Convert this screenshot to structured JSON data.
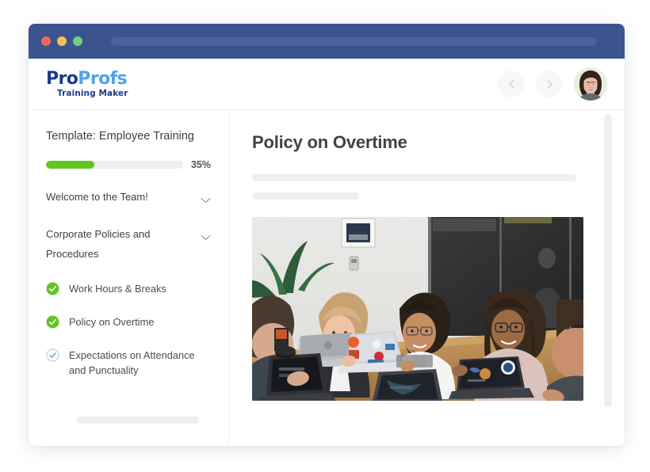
{
  "window": {
    "traffic_lights": [
      "close",
      "minimize",
      "maximize"
    ],
    "colors": {
      "titlebar": "#3b5490",
      "addressbar": "#4a639c",
      "close": "#f1685f",
      "minimize": "#f5c14f",
      "maximize": "#72d07c"
    }
  },
  "header": {
    "logo": {
      "part1": "Pro",
      "part2": "Profs",
      "tagline": "Training Maker",
      "color_part1": "#1b3a8c",
      "color_part2": "#4ea3e8"
    },
    "prev_icon": "chevron-left-icon",
    "next_icon": "chevron-right-icon",
    "avatar_icon": "user-avatar"
  },
  "sidebar": {
    "template_title": "Template: Employee Training",
    "progress": {
      "percent": 35,
      "label": "35%",
      "fill_color": "#62c523",
      "track_color": "#eeeeee"
    },
    "sections": [
      {
        "label": "Welcome to the Team!",
        "icon": "chevron-down-icon",
        "expanded": false
      },
      {
        "label": "Corporate Policies and Procedures",
        "icon": "chevron-down-icon",
        "expanded": true
      }
    ],
    "lessons": [
      {
        "label": "Work Hours & Breaks",
        "status": "complete",
        "icon": "check-circle-filled-icon"
      },
      {
        "label": "Policy on Overtime",
        "status": "complete",
        "icon": "check-circle-filled-icon"
      },
      {
        "label": "Expectations on Attendance and Punctuality",
        "status": "incomplete",
        "icon": "check-circle-outline-icon"
      }
    ],
    "status_colors": {
      "complete": "#62c523",
      "incomplete": "#6fa8dc"
    }
  },
  "main": {
    "page_title": "Policy on Overtime",
    "skeleton_lines": 2,
    "photo_alt": "Team members smiling around a conference table with laptops",
    "scrollbar": "vertical-scrollbar"
  }
}
